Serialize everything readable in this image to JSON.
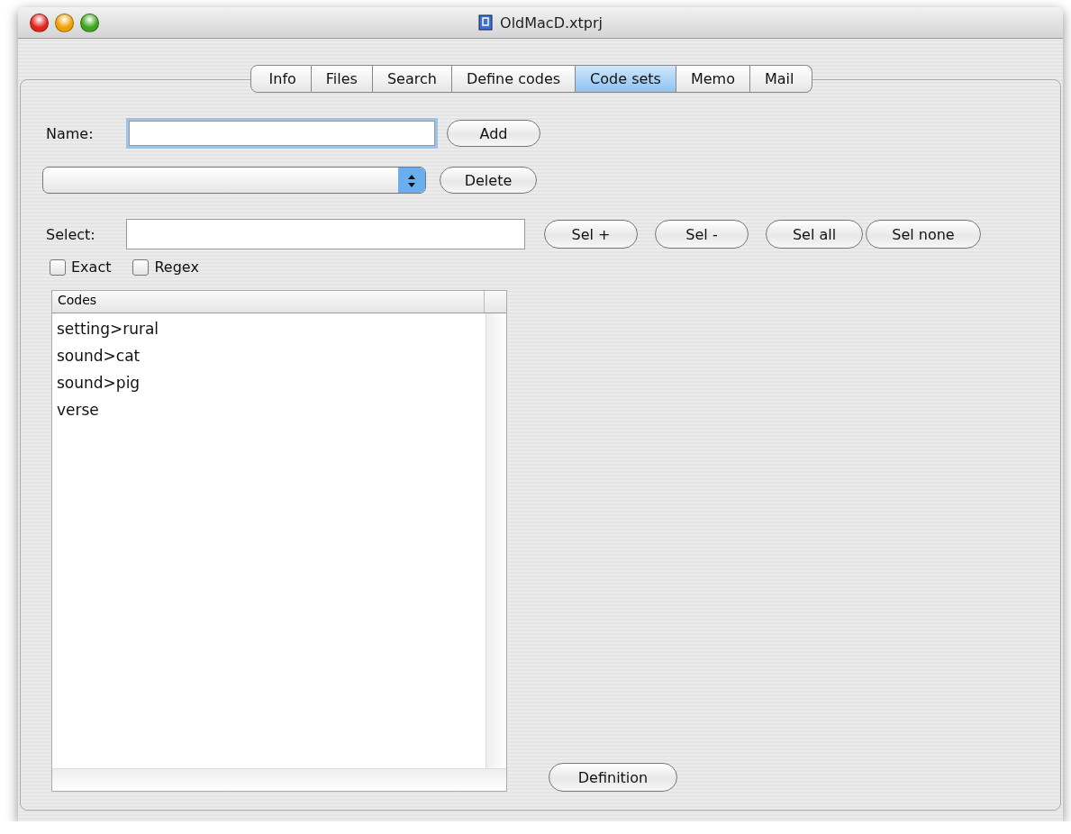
{
  "window": {
    "title": "OldMacD.xtprj"
  },
  "tabs": [
    {
      "label": "Info",
      "selected": false
    },
    {
      "label": "Files",
      "selected": false
    },
    {
      "label": "Search",
      "selected": false
    },
    {
      "label": "Define codes",
      "selected": false
    },
    {
      "label": "Code sets",
      "selected": true
    },
    {
      "label": "Memo",
      "selected": false
    },
    {
      "label": "Mail",
      "selected": false
    }
  ],
  "name_field": {
    "label": "Name:",
    "focused": true
  },
  "add_button": "Add",
  "delete_button": "Delete",
  "select_field": {
    "label": "Select:"
  },
  "select_buttons": [
    "Sel +",
    "Sel -",
    "Sel all",
    "Sel none"
  ],
  "options": [
    {
      "label": "Exact",
      "checked": false
    },
    {
      "label": "Regex",
      "checked": false
    }
  ],
  "codes_table": {
    "column": "Codes",
    "rows": [
      "setting>rural",
      "sound>cat",
      "sound>pig",
      "verse"
    ]
  },
  "definition_button": "Definition"
}
